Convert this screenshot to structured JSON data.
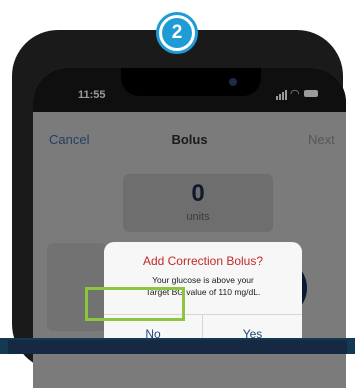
{
  "status_bar": {
    "time": "11:55"
  },
  "step_badge": {
    "number": "2"
  },
  "nav": {
    "cancel": "Cancel",
    "title": "Bolus",
    "next": "Next"
  },
  "units": {
    "value": "0",
    "label": "units"
  },
  "alert": {
    "title": "Add Correction Bolus?",
    "message_line1": "Your glucose is above your",
    "message_line2": "Target BG value of 110 mg/dL.",
    "no": "No",
    "yes": "Yes"
  },
  "colors": {
    "alert_title": "#c3292b",
    "button_text": "#27467a",
    "highlight": "#8cc63f",
    "badge": "#1f9bd6"
  }
}
